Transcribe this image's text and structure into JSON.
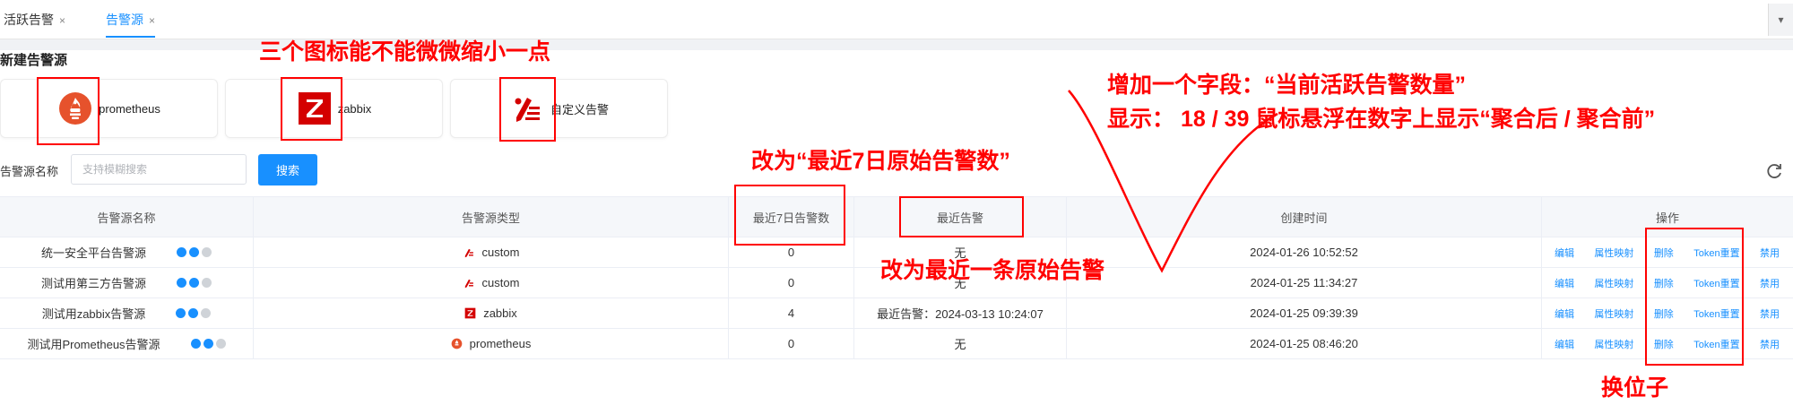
{
  "tabs": [
    {
      "label": "活跃告警",
      "close": "×"
    },
    {
      "label": "告警源",
      "close": "×"
    }
  ],
  "collapse_glyph": "▾",
  "section_title": "新建告警源",
  "sources": [
    {
      "label": "prometheus",
      "icon": "prometheus-logo-icon"
    },
    {
      "label": "zabbix",
      "icon": "zabbix-logo-icon"
    },
    {
      "label": "自定义告警",
      "icon": "custom-alert-icon"
    }
  ],
  "filter": {
    "label": "告警源名称",
    "placeholder": "支持模糊搜索",
    "button": "搜索"
  },
  "table": {
    "headers": [
      "告警源名称",
      "告警源类型",
      "最近7日告警数",
      "最近告警",
      "创建时间",
      "操作"
    ],
    "rows": [
      {
        "name": "统一安全平台告警源",
        "type": "custom",
        "count": "0",
        "recent": "无",
        "created": "2024-01-26 10:52:52"
      },
      {
        "name": "测试用第三方告警源",
        "type": "custom",
        "count": "0",
        "recent": "无",
        "created": "2024-01-25 11:34:27"
      },
      {
        "name": "测试用zabbix告警源",
        "type": "zabbix",
        "count": "4",
        "recent": "最近告警：2024-03-13 10:24:07",
        "created": "2024-01-25 09:39:39"
      },
      {
        "name": "测试用Prometheus告警源",
        "type": "prometheus",
        "count": "0",
        "recent": "无",
        "created": "2024-01-25 08:46:20"
      }
    ],
    "ops": [
      "编辑",
      "属性映射",
      "删除",
      "Token重置",
      "禁用"
    ]
  },
  "annotations": {
    "icons_smaller": "三个图标能不能微微缩小一点",
    "add_field_line1": "增加一个字段：“当前活跃告警数量”",
    "add_field_line2": "显示：  18 / 39   鼠标悬浮在数字上显示“聚合后 / 聚合前”",
    "rename_count": "改为“最近7日原始告警数”",
    "rename_recent": "改为最近一条原始告警",
    "swap": "换位子"
  },
  "colors": {
    "accent": "#1890ff",
    "annotation": "#ff0000",
    "prometheus": "#e6522c",
    "zabbix": "#d40000",
    "status_gear": "#1890ff",
    "status_check": "#1890ff",
    "status_shield": "#cfd3d8"
  }
}
